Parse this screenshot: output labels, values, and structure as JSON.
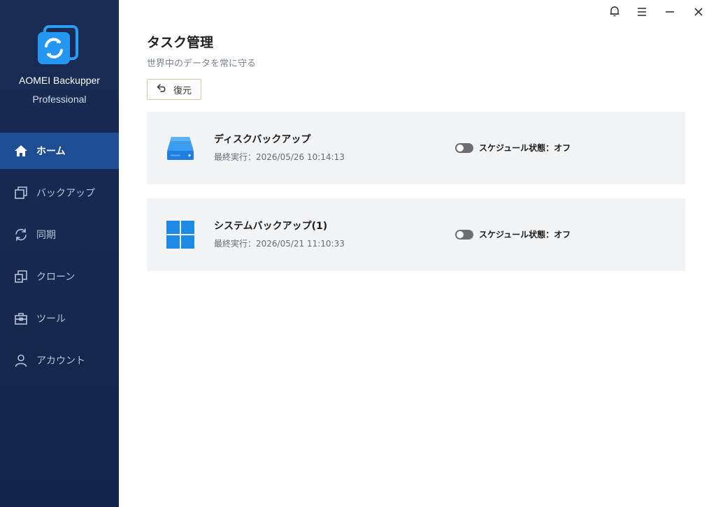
{
  "app": {
    "name": "AOMEI Backupper",
    "edition": "Professional"
  },
  "sidebar": {
    "items": [
      {
        "label": "ホーム",
        "icon": "home-icon",
        "active": true
      },
      {
        "label": "バックアップ",
        "icon": "backup-icon",
        "active": false
      },
      {
        "label": "同期",
        "icon": "sync-icon",
        "active": false
      },
      {
        "label": "クローン",
        "icon": "clone-icon",
        "active": false
      },
      {
        "label": "ツール",
        "icon": "toolbox-icon",
        "active": false
      },
      {
        "label": "アカウント",
        "icon": "user-icon",
        "active": false
      }
    ]
  },
  "titlebar": {
    "icons": [
      "bell-icon",
      "menu-icon",
      "minimize-icon",
      "close-icon"
    ]
  },
  "page": {
    "title": "タスク管理",
    "subtitle": "世界中のデータを常に守る",
    "restore_label": "復元"
  },
  "tasks": [
    {
      "name": "ディスクバックアップ",
      "last_run": "最終実行：2026/05/26 10:14:13",
      "schedule": "スケジュール状態：オフ",
      "icon": "disk-icon"
    },
    {
      "name": "システムバックアップ(1)",
      "last_run": "最終実行：2026/05/21 11:10:33",
      "schedule": "スケジュール状態：オフ",
      "icon": "windows-icon"
    }
  ],
  "colors": {
    "sidebar_bg": "#182c55",
    "active_nav": "#1e4d92",
    "accent_blue": "#1e88e5",
    "card_bg": "#f3f4f6"
  }
}
